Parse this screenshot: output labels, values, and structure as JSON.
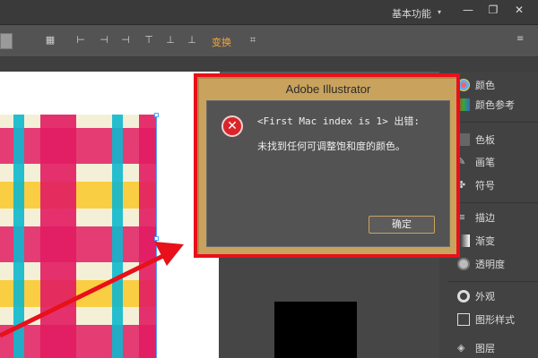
{
  "titlebar": {
    "workspace": "基本功能",
    "min_icon": "minimize-icon",
    "max_icon": "restore-icon",
    "close_icon": "close-icon"
  },
  "controlbar": {
    "transform_label": "变换"
  },
  "dialog": {
    "title": "Adobe Illustrator",
    "line1": "<First Mac index is 1> 出错:",
    "line2": "未找到任何可调整饱和度的颜色。",
    "ok_label": "确定",
    "error_icon": "error-x-icon"
  },
  "right_panel": {
    "items": [
      {
        "label": "颜色",
        "icon": "color-icon"
      },
      {
        "label": "颜色参考",
        "icon": "color-guide-icon"
      },
      {
        "label": "色板",
        "icon": "swatches-icon"
      },
      {
        "label": "画笔",
        "icon": "brush-icon"
      },
      {
        "label": "符号",
        "icon": "symbol-icon"
      },
      {
        "label": "描边",
        "icon": "stroke-icon"
      },
      {
        "label": "渐变",
        "icon": "gradient-icon"
      },
      {
        "label": "透明度",
        "icon": "transparency-icon"
      },
      {
        "label": "外观",
        "icon": "appearance-icon"
      },
      {
        "label": "图形样式",
        "icon": "graphic-styles-icon"
      },
      {
        "label": "图层",
        "icon": "layers-icon"
      }
    ]
  },
  "annotation": {
    "highlight_color": "#e8101a",
    "accent_color": "#c9a35e"
  }
}
